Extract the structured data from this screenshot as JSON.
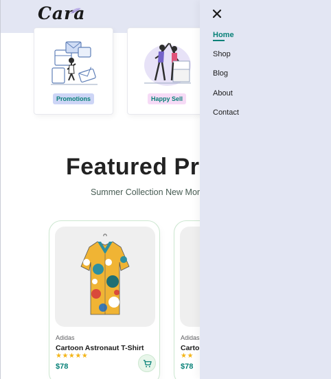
{
  "header": {
    "logo_text": "Cara"
  },
  "features": [
    {
      "label": "Promotions",
      "icon": "promotions-illustration",
      "tag_color": "#cdd5f6"
    },
    {
      "label": "Happy Sell",
      "icon": "happy-sell-illustration",
      "tag_color": "#f6dbf6"
    }
  ],
  "section": {
    "title": "Featured Pro",
    "subtitle": "Summer Collection New Mor"
  },
  "products": [
    {
      "brand": "Adidas",
      "name": "Cartoon Astronaut T-Shirt",
      "stars": "★★★★★",
      "price": "$78"
    },
    {
      "brand": "Adidas",
      "name": "Carto",
      "stars": "★★",
      "price": "$78"
    }
  ],
  "nav": {
    "items": [
      {
        "label": "Home",
        "active": true
      },
      {
        "label": "Shop",
        "active": false
      },
      {
        "label": "Blog",
        "active": false
      },
      {
        "label": "About",
        "active": false
      },
      {
        "label": "Contact",
        "active": false
      }
    ]
  },
  "colors": {
    "accent": "#088178",
    "header_bg": "#e3e6f3",
    "star": "#f3b519"
  }
}
